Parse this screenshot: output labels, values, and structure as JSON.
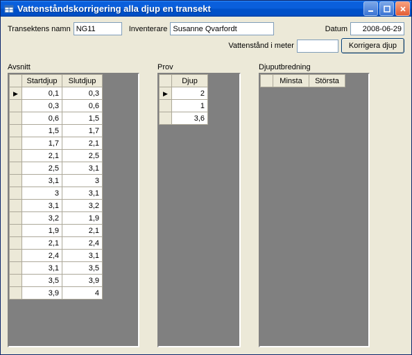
{
  "window": {
    "title": "Vattenståndskorrigering alla djup en transekt"
  },
  "form": {
    "transect_label": "Transektens namn",
    "transect_value": "NG11",
    "inventory_label": "Inventerare",
    "inventory_value": "Susanne Qvarfordt",
    "date_label": "Datum",
    "date_value": "2008-06-29",
    "waterlevel_label": "Vattenstånd i meter",
    "waterlevel_value": "",
    "correct_button": "Korrigera djup"
  },
  "panels": {
    "avsnitt": {
      "label": "Avsnitt",
      "columns": [
        "Startdjup",
        "Slutdjup"
      ],
      "rows": [
        [
          "0,1",
          "0,3"
        ],
        [
          "0,3",
          "0,6"
        ],
        [
          "0,6",
          "1,5"
        ],
        [
          "1,5",
          "1,7"
        ],
        [
          "1,7",
          "2,1"
        ],
        [
          "2,1",
          "2,5"
        ],
        [
          "2,5",
          "3,1"
        ],
        [
          "3,1",
          "3"
        ],
        [
          "3",
          "3,1"
        ],
        [
          "3,1",
          "3,2"
        ],
        [
          "3,2",
          "1,9"
        ],
        [
          "1,9",
          "2,1"
        ],
        [
          "2,1",
          "2,4"
        ],
        [
          "2,4",
          "3,1"
        ],
        [
          "3,1",
          "3,5"
        ],
        [
          "3,5",
          "3,9"
        ],
        [
          "3,9",
          "4"
        ]
      ]
    },
    "prov": {
      "label": "Prov",
      "columns": [
        "Djup"
      ],
      "rows": [
        [
          "2"
        ],
        [
          "1"
        ],
        [
          "3,6"
        ]
      ]
    },
    "djuput": {
      "label": "Djuputbredning",
      "columns": [
        "Minsta",
        "Största"
      ],
      "rows": []
    }
  }
}
